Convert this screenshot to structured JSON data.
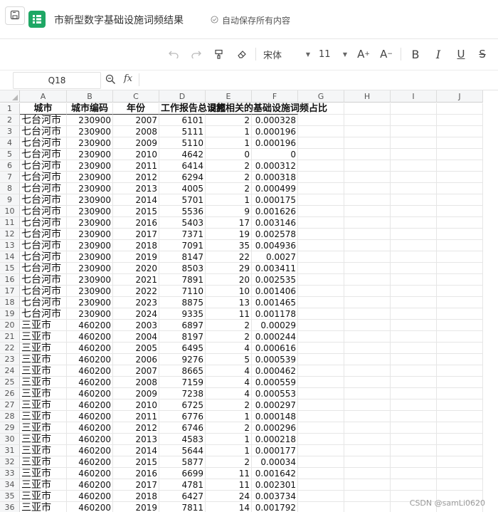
{
  "doc": {
    "title": "市新型数字基础设施词频结果",
    "save_status": "自动保存所有内容"
  },
  "toolbar": {
    "font_name": "宋体",
    "font_size": "11",
    "bold": "B",
    "italic": "I",
    "underline": "U",
    "strike": "S",
    "fx": "fx"
  },
  "formula_bar": {
    "cell_ref": "Q18",
    "formula": ""
  },
  "columns": [
    "A",
    "B",
    "C",
    "D",
    "E",
    "F",
    "G",
    "H",
    "I",
    "J"
  ],
  "header_row": [
    "城市",
    "城市编码",
    "年份",
    "工作报告总词频",
    "设施相关的",
    "基础设施词频占比"
  ],
  "rows": [
    [
      "1",
      "",
      "",
      "",
      "",
      "",
      ""
    ],
    [
      "2",
      "七台河市",
      "230900",
      "2007",
      "6101",
      "2",
      "0.000328"
    ],
    [
      "3",
      "七台河市",
      "230900",
      "2008",
      "5111",
      "1",
      "0.000196"
    ],
    [
      "4",
      "七台河市",
      "230900",
      "2009",
      "5110",
      "1",
      "0.000196"
    ],
    [
      "5",
      "七台河市",
      "230900",
      "2010",
      "4642",
      "0",
      "0"
    ],
    [
      "6",
      "七台河市",
      "230900",
      "2011",
      "6414",
      "2",
      "0.000312"
    ],
    [
      "7",
      "七台河市",
      "230900",
      "2012",
      "6294",
      "2",
      "0.000318"
    ],
    [
      "8",
      "七台河市",
      "230900",
      "2013",
      "4005",
      "2",
      "0.000499"
    ],
    [
      "9",
      "七台河市",
      "230900",
      "2014",
      "5701",
      "1",
      "0.000175"
    ],
    [
      "10",
      "七台河市",
      "230900",
      "2015",
      "5536",
      "9",
      "0.001626"
    ],
    [
      "11",
      "七台河市",
      "230900",
      "2016",
      "5403",
      "17",
      "0.003146"
    ],
    [
      "12",
      "七台河市",
      "230900",
      "2017",
      "7371",
      "19",
      "0.002578"
    ],
    [
      "13",
      "七台河市",
      "230900",
      "2018",
      "7091",
      "35",
      "0.004936"
    ],
    [
      "14",
      "七台河市",
      "230900",
      "2019",
      "8147",
      "22",
      "0.0027"
    ],
    [
      "15",
      "七台河市",
      "230900",
      "2020",
      "8503",
      "29",
      "0.003411"
    ],
    [
      "16",
      "七台河市",
      "230900",
      "2021",
      "7891",
      "20",
      "0.002535"
    ],
    [
      "17",
      "七台河市",
      "230900",
      "2022",
      "7110",
      "10",
      "0.001406"
    ],
    [
      "18",
      "七台河市",
      "230900",
      "2023",
      "8875",
      "13",
      "0.001465"
    ],
    [
      "19",
      "七台河市",
      "230900",
      "2024",
      "9335",
      "11",
      "0.001178"
    ],
    [
      "20",
      "三亚市",
      "460200",
      "2003",
      "6897",
      "2",
      "0.00029"
    ],
    [
      "21",
      "三亚市",
      "460200",
      "2004",
      "8197",
      "2",
      "0.000244"
    ],
    [
      "22",
      "三亚市",
      "460200",
      "2005",
      "6495",
      "4",
      "0.000616"
    ],
    [
      "23",
      "三亚市",
      "460200",
      "2006",
      "9276",
      "5",
      "0.000539"
    ],
    [
      "24",
      "三亚市",
      "460200",
      "2007",
      "8665",
      "4",
      "0.000462"
    ],
    [
      "25",
      "三亚市",
      "460200",
      "2008",
      "7159",
      "4",
      "0.000559"
    ],
    [
      "26",
      "三亚市",
      "460200",
      "2009",
      "7238",
      "4",
      "0.000553"
    ],
    [
      "27",
      "三亚市",
      "460200",
      "2010",
      "6725",
      "2",
      "0.000297"
    ],
    [
      "28",
      "三亚市",
      "460200",
      "2011",
      "6776",
      "1",
      "0.000148"
    ],
    [
      "29",
      "三亚市",
      "460200",
      "2012",
      "6746",
      "2",
      "0.000296"
    ],
    [
      "30",
      "三亚市",
      "460200",
      "2013",
      "4583",
      "1",
      "0.000218"
    ],
    [
      "31",
      "三亚市",
      "460200",
      "2014",
      "5644",
      "1",
      "0.000177"
    ],
    [
      "32",
      "三亚市",
      "460200",
      "2015",
      "5877",
      "2",
      "0.00034"
    ],
    [
      "33",
      "三亚市",
      "460200",
      "2016",
      "6699",
      "11",
      "0.001642"
    ],
    [
      "34",
      "三亚市",
      "460200",
      "2017",
      "4781",
      "11",
      "0.002301"
    ],
    [
      "35",
      "三亚市",
      "460200",
      "2018",
      "6427",
      "24",
      "0.003734"
    ],
    [
      "36",
      "三亚市",
      "460200",
      "2019",
      "7811",
      "14",
      "0.001792"
    ]
  ],
  "watermark": "CSDN @samLi0620"
}
